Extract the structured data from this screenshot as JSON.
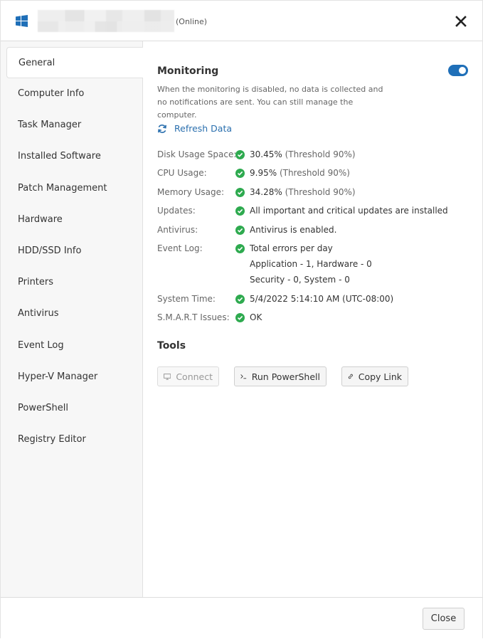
{
  "header": {
    "status": "(Online)",
    "icons": {
      "os": "windows-logo-icon",
      "close": "close-icon"
    }
  },
  "sidebar": {
    "items": [
      {
        "label": "General",
        "active": true
      },
      {
        "label": "Computer Info"
      },
      {
        "label": "Task Manager"
      },
      {
        "label": "Installed Software"
      },
      {
        "label": "Patch Management"
      },
      {
        "label": "Hardware"
      },
      {
        "label": "HDD/SSD Info"
      },
      {
        "label": "Printers"
      },
      {
        "label": "Antivirus"
      },
      {
        "label": "Event Log"
      },
      {
        "label": "Hyper-V Manager"
      },
      {
        "label": "PowerShell"
      },
      {
        "label": "Registry Editor"
      }
    ]
  },
  "monitoring": {
    "title": "Monitoring",
    "enabled": true,
    "description": "When the monitoring is disabled, no data is collected and no notifications are sent. You can still manage the computer.",
    "refresh_label": "Refresh Data",
    "rows": [
      {
        "label": "Disk Usage Space:",
        "value": "30.45%",
        "threshold": " (Threshold 90%)"
      },
      {
        "label": "CPU Usage:",
        "value": "9.95%",
        "threshold": " (Threshold 90%)"
      },
      {
        "label": "Memory Usage:",
        "value": "34.28%",
        "threshold": " (Threshold 90%)"
      },
      {
        "label": "Updates:",
        "value": "All important and critical updates are installed"
      },
      {
        "label": "Antivirus:",
        "value": "Antivirus is enabled."
      },
      {
        "label": "Event Log:",
        "value": "Total errors per day",
        "line2": "Application - 1, Hardware - 0",
        "line3": "Security - 0, System - 0"
      },
      {
        "label": "System Time:",
        "value": "5/4/2022 5:14:10 AM (UTC-08:00)"
      },
      {
        "label": "S.M.A.R.T Issues:",
        "value": "OK"
      }
    ]
  },
  "tools": {
    "title": "Tools",
    "connect_label": "Connect",
    "powershell_label": "Run PowerShell",
    "copy_link_label": "Copy Link"
  },
  "footer": {
    "close_label": "Close"
  },
  "colors": {
    "accent": "#1f6fb8",
    "success": "#2eaa4f",
    "link": "#2a6fae"
  }
}
